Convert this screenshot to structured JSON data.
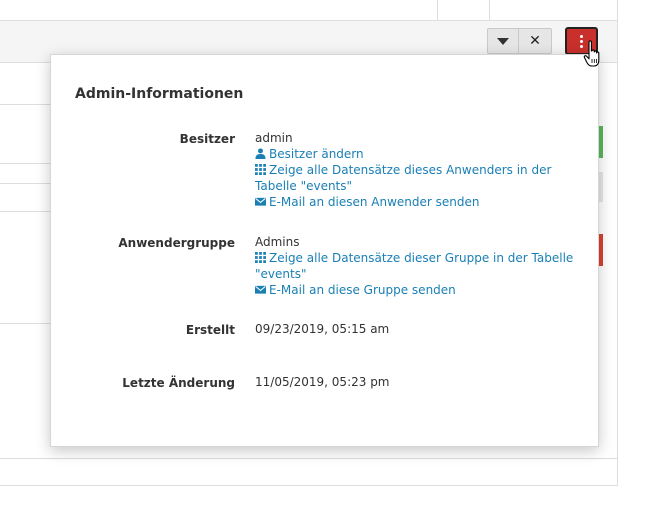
{
  "toolbar": {
    "dropdown_icon": "caret-down-icon",
    "close_icon": "times-icon",
    "admin_icon": "ellipsis-vertical-icon",
    "admin_color": "#c9302c"
  },
  "popover": {
    "title": "Admin-Informationen",
    "owner": {
      "label": "Besitzer",
      "value": "admin",
      "links": [
        {
          "icon": "user-icon",
          "text": "Besitzer ändern"
        },
        {
          "icon": "grid-icon",
          "text": "Zeige alle Datensätze dieses Anwenders in der Tabelle \"events\""
        },
        {
          "icon": "envelope-icon",
          "text": "E-Mail an diesen Anwender senden"
        }
      ]
    },
    "group": {
      "label": "Anwendergruppe",
      "value": "Admins",
      "links": [
        {
          "icon": "grid-icon",
          "text": "Zeige alle Datensätze dieser Gruppe in der Tabelle \"events\""
        },
        {
          "icon": "envelope-icon",
          "text": "E-Mail an diese Gruppe senden"
        }
      ]
    },
    "created": {
      "label": "Erstellt",
      "value": "09/23/2019, 05:15 am"
    },
    "modified": {
      "label": "Letzte Änderung",
      "value": "11/05/2019, 05:23 pm"
    }
  },
  "colors": {
    "link": "#1a7fb5",
    "strip_green": "#5cb85c",
    "strip_red": "#d9432f"
  }
}
